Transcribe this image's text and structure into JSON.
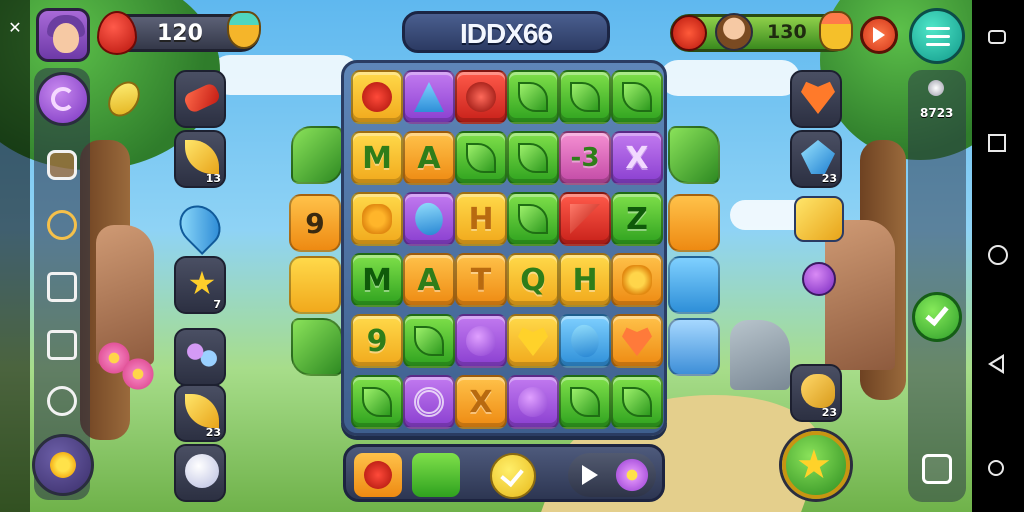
{
  "window": {
    "close_label": "✕"
  },
  "header": {
    "coins": "120",
    "level_code": "IDDX66",
    "opponent_score": "130"
  },
  "left_slots": [
    {
      "count": ""
    },
    {
      "count": "13"
    },
    {
      "count": ""
    },
    {
      "count": "7"
    },
    {
      "count": ""
    },
    {
      "count": "23"
    },
    {
      "count": ""
    }
  ],
  "right_slots": [
    {
      "count": ""
    },
    {
      "count": "23"
    },
    {
      "count": ""
    },
    {
      "count": ""
    },
    {
      "count": ""
    },
    {
      "count": "23"
    }
  ],
  "right_panel": {
    "counter": "8723"
  },
  "board": {
    "rows": [
      [
        "",
        "",
        "",
        "",
        "",
        ""
      ],
      [
        "M",
        "A",
        "",
        "",
        "-3",
        "X"
      ],
      [
        "",
        "",
        "H",
        "",
        "",
        "Z"
      ],
      [
        "M",
        "A",
        "T",
        "Q",
        "H",
        ""
      ],
      [
        "9",
        "",
        "",
        "",
        "",
        ""
      ],
      [
        "",
        "",
        "X",
        "",
        "",
        ""
      ]
    ],
    "left_edge": [
      "9",
      ""
    ],
    "colors": {
      "yellow": "#f1a91c",
      "green": "#2fa21f",
      "purple": "#8a3fd0",
      "red": "#c8211a",
      "orange": "#ee8a12",
      "pink": "#c24aa6",
      "blue": "#2e8fd8"
    }
  },
  "icons": {
    "close": "close-icon",
    "menu": "hamburger-menu-icon",
    "check": "checkmark-icon",
    "play": "play-icon",
    "star": "star-icon"
  }
}
